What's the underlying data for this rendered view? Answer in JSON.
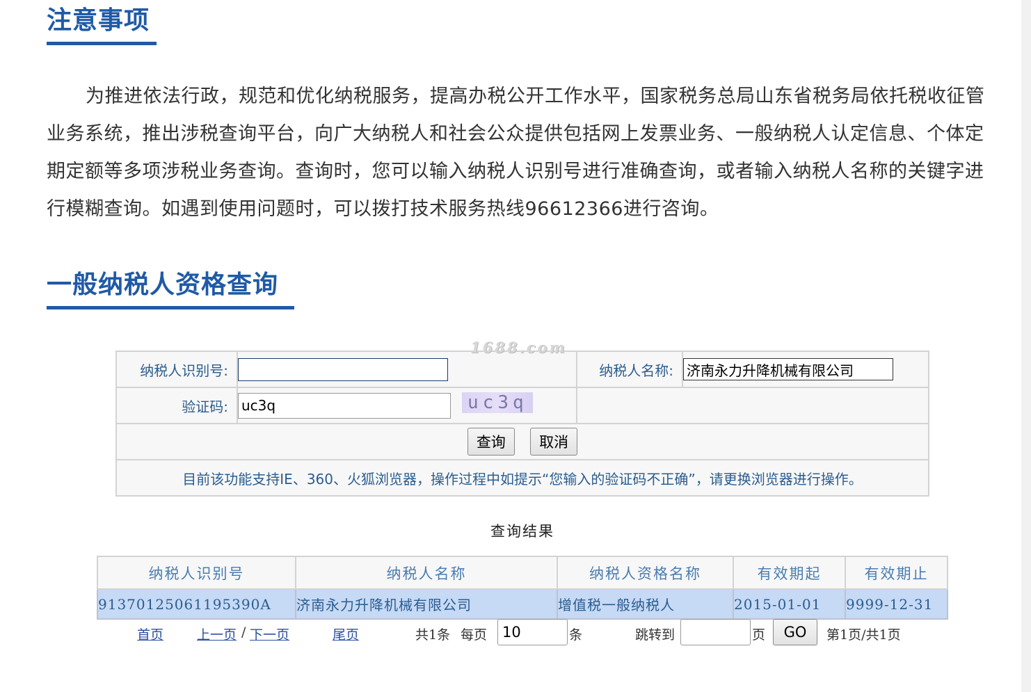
{
  "notice": {
    "title": "注意事项",
    "body": "为推进依法行政，规范和优化纳税服务，提高办税公开工作水平，国家税务总局山东省税务局依托税收征管业务系统，推出涉税查询平台，向广大纳税人和社会公众提供包括网上发票业务、一般纳税人认定信息、个体定期定额等多项涉税业务查询。查询时，您可以输入纳税人识别号进行准确查询，或者输入纳税人名称的关键字进行模糊查询。如遇到使用问题时，可以拨打技术服务热线96612366进行咨询。"
  },
  "query": {
    "title": "一般纳税人资格查询",
    "watermark": "1688.com",
    "taxid_label": "纳税人识别号:",
    "taxid_value": "",
    "name_label": "纳税人名称:",
    "name_value": "济南永力升降机械有限公司",
    "captcha_label": "验证码:",
    "captcha_value": "uc3q",
    "captcha_image_text": "uc3q",
    "submit_label": "查询",
    "cancel_label": "取消",
    "tip": "目前该功能支持IE、360、火狐浏览器，操作过程中如提示“您输入的验证码不正确”，请更换浏览器进行操作。"
  },
  "result": {
    "title": "查询结果",
    "columns": [
      "纳税人识别号",
      "纳税人名称",
      "纳税人资格名称",
      "有效期起",
      "有效期止"
    ],
    "rows": [
      [
        "91370125061195390A",
        "济南永力升降机械有限公司",
        "增值税一般纳税人",
        "2015-01-01",
        "9999-12-31"
      ]
    ]
  },
  "pager": {
    "first": "首页",
    "prev": "上一页",
    "separator": "/",
    "next": "下一页",
    "last": "尾页",
    "total": "共1条",
    "per_page_label": "每页",
    "per_page_value": "10",
    "per_page_unit": "条",
    "jump_label": "跳转到",
    "jump_value": "",
    "page_unit": "页",
    "go_label": "GO",
    "page_info": "第1页/共1页"
  }
}
